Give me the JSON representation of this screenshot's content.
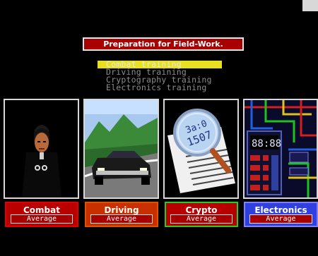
{
  "title": "Preparation for Field-Work.",
  "menu": [
    {
      "label": "Combat training",
      "selected": true
    },
    {
      "label": "Driving training",
      "selected": false
    },
    {
      "label": "Cryptography training",
      "selected": false
    },
    {
      "label": "Electronics training",
      "selected": false
    }
  ],
  "skills": [
    {
      "name": "Combat",
      "level": "Average",
      "name_bg": "#b80000",
      "frame": "#e00000"
    },
    {
      "name": "Driving",
      "level": "Average",
      "name_bg": "#c83000",
      "frame": "#e05000"
    },
    {
      "name": "Crypto",
      "level": "Average",
      "name_bg": "#b80000",
      "frame": "#20d020"
    },
    {
      "name": "Electronics",
      "level": "Average",
      "name_bg": "#3040e0",
      "frame": "#8080ff"
    }
  ],
  "crypto_text": [
    "3a:0",
    "1507"
  ],
  "electronics_display": "88:88"
}
